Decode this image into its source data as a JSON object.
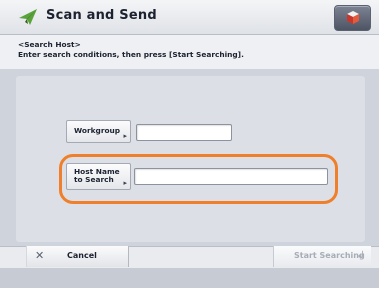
{
  "header": {
    "title": "Scan and Send",
    "app_icon": "paper-plane-icon",
    "corner_icon": "status-cube-icon"
  },
  "info": {
    "heading": "<Search Host>",
    "instruction": "Enter search conditions, then press [Start Searching]."
  },
  "form": {
    "workgroup_label": "Workgroup",
    "workgroup_value": "",
    "host_label_line1": "Host Name",
    "host_label_line2": "to Search",
    "host_value": ""
  },
  "footer": {
    "cancel_label": "Cancel",
    "start_label": "Start Searching",
    "start_enabled": false
  },
  "colors": {
    "highlight": "#ef7f2a",
    "app_icon_green": "#5aa23a"
  }
}
